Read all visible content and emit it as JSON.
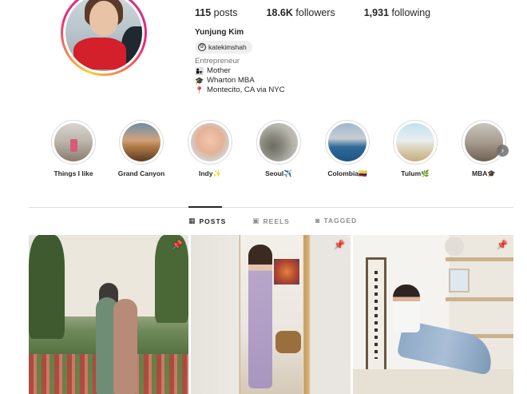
{
  "profile": {
    "stats": {
      "posts_count": "115",
      "posts_label": "posts",
      "followers_count": "18.6K",
      "followers_label": "followers",
      "following_count": "1,931",
      "following_label": "following"
    },
    "name": "Yunjung Kim",
    "threads_handle": "katekimshah",
    "category": "Entrepreneur",
    "bio_lines": [
      {
        "emoji": "👩‍👧",
        "text": "Mother"
      },
      {
        "emoji": "🎓",
        "text": "Wharton MBA"
      },
      {
        "emoji": "📍",
        "text": "Montecito, CA via NYC"
      }
    ]
  },
  "highlights": [
    {
      "label": "Things I like"
    },
    {
      "label": "Grand Canyon"
    },
    {
      "label": "Indy✨"
    },
    {
      "label": "Seoul✈️"
    },
    {
      "label": "Colombia🇨🇴"
    },
    {
      "label": "Tulum🌿"
    },
    {
      "label": "MBA🎓"
    }
  ],
  "tabs": {
    "posts": "POSTS",
    "reels": "REELS",
    "tagged": "TAGGED",
    "active": "posts"
  },
  "icons": {
    "next": "chevron-right-icon",
    "pin": "pin-icon",
    "grid": "grid-icon",
    "reels": "reels-icon",
    "tagged": "tagged-icon",
    "threads": "threads-icon"
  },
  "colors": {
    "text": "#262626",
    "muted": "#737373",
    "divider": "#dbdbdb"
  }
}
